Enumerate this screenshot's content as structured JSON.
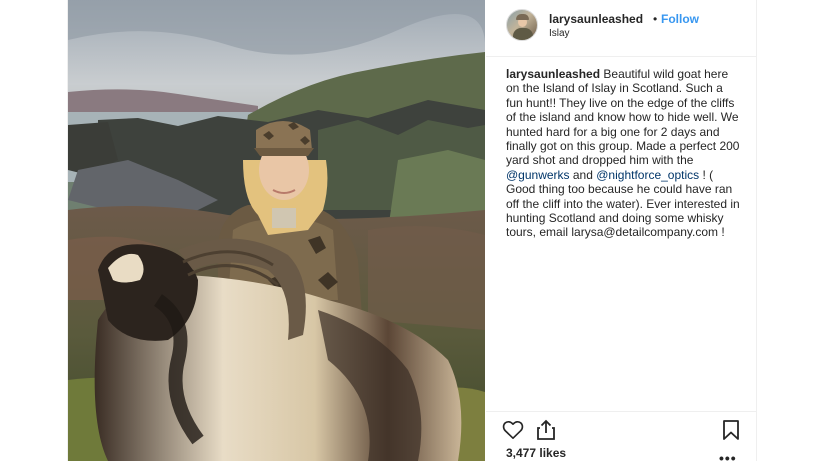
{
  "post": {
    "username": "larysaunleashed",
    "separator": "•",
    "follow_label": "Follow",
    "location": "Islay",
    "caption": {
      "user": "larysaunleashed",
      "text_1": " Beautiful wild goat here on the Island of Islay in Scotland. Such a fun hunt!! They live on the edge of the cliffs of the island and know how to hide well. We hunted hard for a big one for 2 days and finally got on this group. Made a perfect 200 yard shot and dropped him with the ",
      "mention_1": "@gunwerks",
      "text_2": " and ",
      "mention_2": "@nightforce_optics",
      "text_3": " ! ( Good thing too because he could have ran off the cliff into the water). Ever interested in hunting Scotland and doing some whisky tours, email larysa@detailcompany.com !"
    },
    "likes": "3,477 likes",
    "more_label": "•••"
  },
  "icons": {
    "like": "heart-icon",
    "share": "share-icon",
    "save": "bookmark-icon"
  },
  "colors": {
    "link": "#3897f0",
    "mention": "#003569",
    "text": "#262626",
    "divider": "#efefef"
  }
}
